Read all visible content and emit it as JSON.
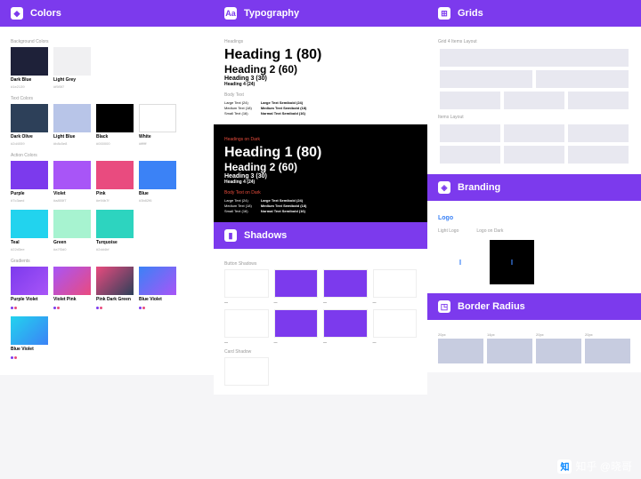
{
  "headers": {
    "colors": "Colors",
    "typography": "Typography",
    "grids": "Grids",
    "shadows": "Shadows",
    "branding": "Branding",
    "borderRadius": "Border Radius"
  },
  "colors": {
    "sections": {
      "background": "Background Colors",
      "text": "Text Colors",
      "action": "Action Colors",
      "gradients": "Gradients"
    },
    "background": [
      {
        "name": "Dark Blue",
        "hex": "#1e2139",
        "color": "#1e2139"
      },
      {
        "name": "Light Grey",
        "hex": "#f5f5f7",
        "color": "#f0f0f2"
      }
    ],
    "text": [
      {
        "name": "Dark Olive",
        "hex": "#2d4059",
        "color": "#2d4059"
      },
      {
        "name": "Light Blue",
        "hex": "#b8c5e8",
        "color": "#b8c5e8"
      },
      {
        "name": "Black",
        "hex": "#000000",
        "color": "#000000"
      },
      {
        "name": "White",
        "hex": "#ffffff",
        "color": "#ffffff"
      }
    ],
    "action": [
      {
        "name": "Purple",
        "hex": "#7c3aed",
        "color": "#7c3aed"
      },
      {
        "name": "Violet",
        "hex": "#a855f7",
        "color": "#a855f7"
      },
      {
        "name": "Pink",
        "hex": "#e94b7f",
        "color": "#e94b7f"
      },
      {
        "name": "Blue",
        "hex": "#3b82f6",
        "color": "#3b82f6"
      },
      {
        "name": "Teal",
        "hex": "#22d3ee",
        "color": "#22d3ee"
      },
      {
        "name": "Green",
        "hex": "#a7f3d0",
        "color": "#a7f3d0"
      },
      {
        "name": "Turquoise",
        "hex": "#2dd4bf",
        "color": "#2dd4bf"
      }
    ],
    "gradients": [
      {
        "name": "Purple Violet",
        "g": "linear-gradient(135deg,#7c3aed,#a855f7)"
      },
      {
        "name": "Violet Pink",
        "g": "linear-gradient(135deg,#a855f7,#e94b7f)"
      },
      {
        "name": "Pink Dark Green",
        "g": "linear-gradient(135deg,#e94b7f,#2d4059)"
      },
      {
        "name": "Blue Violet",
        "g": "linear-gradient(135deg,#3b82f6,#a855f7)"
      },
      {
        "name": "Blue Violet",
        "g": "linear-gradient(135deg,#22d3ee,#3b82f6)"
      }
    ]
  },
  "typography": {
    "headingsLabel": "Headings",
    "headingsDarkLabel": "Headings on Dark",
    "bodyLabel": "Body Text",
    "bodyDarkLabel": "Body Text on Dark",
    "h1": "Heading 1 (80)",
    "h2": "Heading 2 (60)",
    "h3": "Heading 3 (30)",
    "h4": "Heading 4 (24)",
    "bodyLeft": [
      "Large Text (24)",
      "Medium Text (18)",
      "Small Text (16)"
    ],
    "bodyRight": [
      "Large Text Semibold (24)",
      "Medium Text Semibold (18)",
      "Normal Text Semibold (16)"
    ]
  },
  "grids": {
    "label1": "Grid 4 Items Layout",
    "label2": "Items Layout"
  },
  "shadows": {
    "label": "Button Shadows",
    "label2": "Card Shadow",
    "items": [
      "",
      "",
      "",
      "",
      "",
      "",
      "",
      ""
    ]
  },
  "branding": {
    "logoLabel": "Logo",
    "logoLight": "Light Logo",
    "logoDark": "Logo on Dark",
    "mark": "I"
  },
  "radius": {
    "items": [
      "20px",
      "14px",
      "20px",
      "20px"
    ]
  },
  "watermark": "知乎 @晓哥"
}
